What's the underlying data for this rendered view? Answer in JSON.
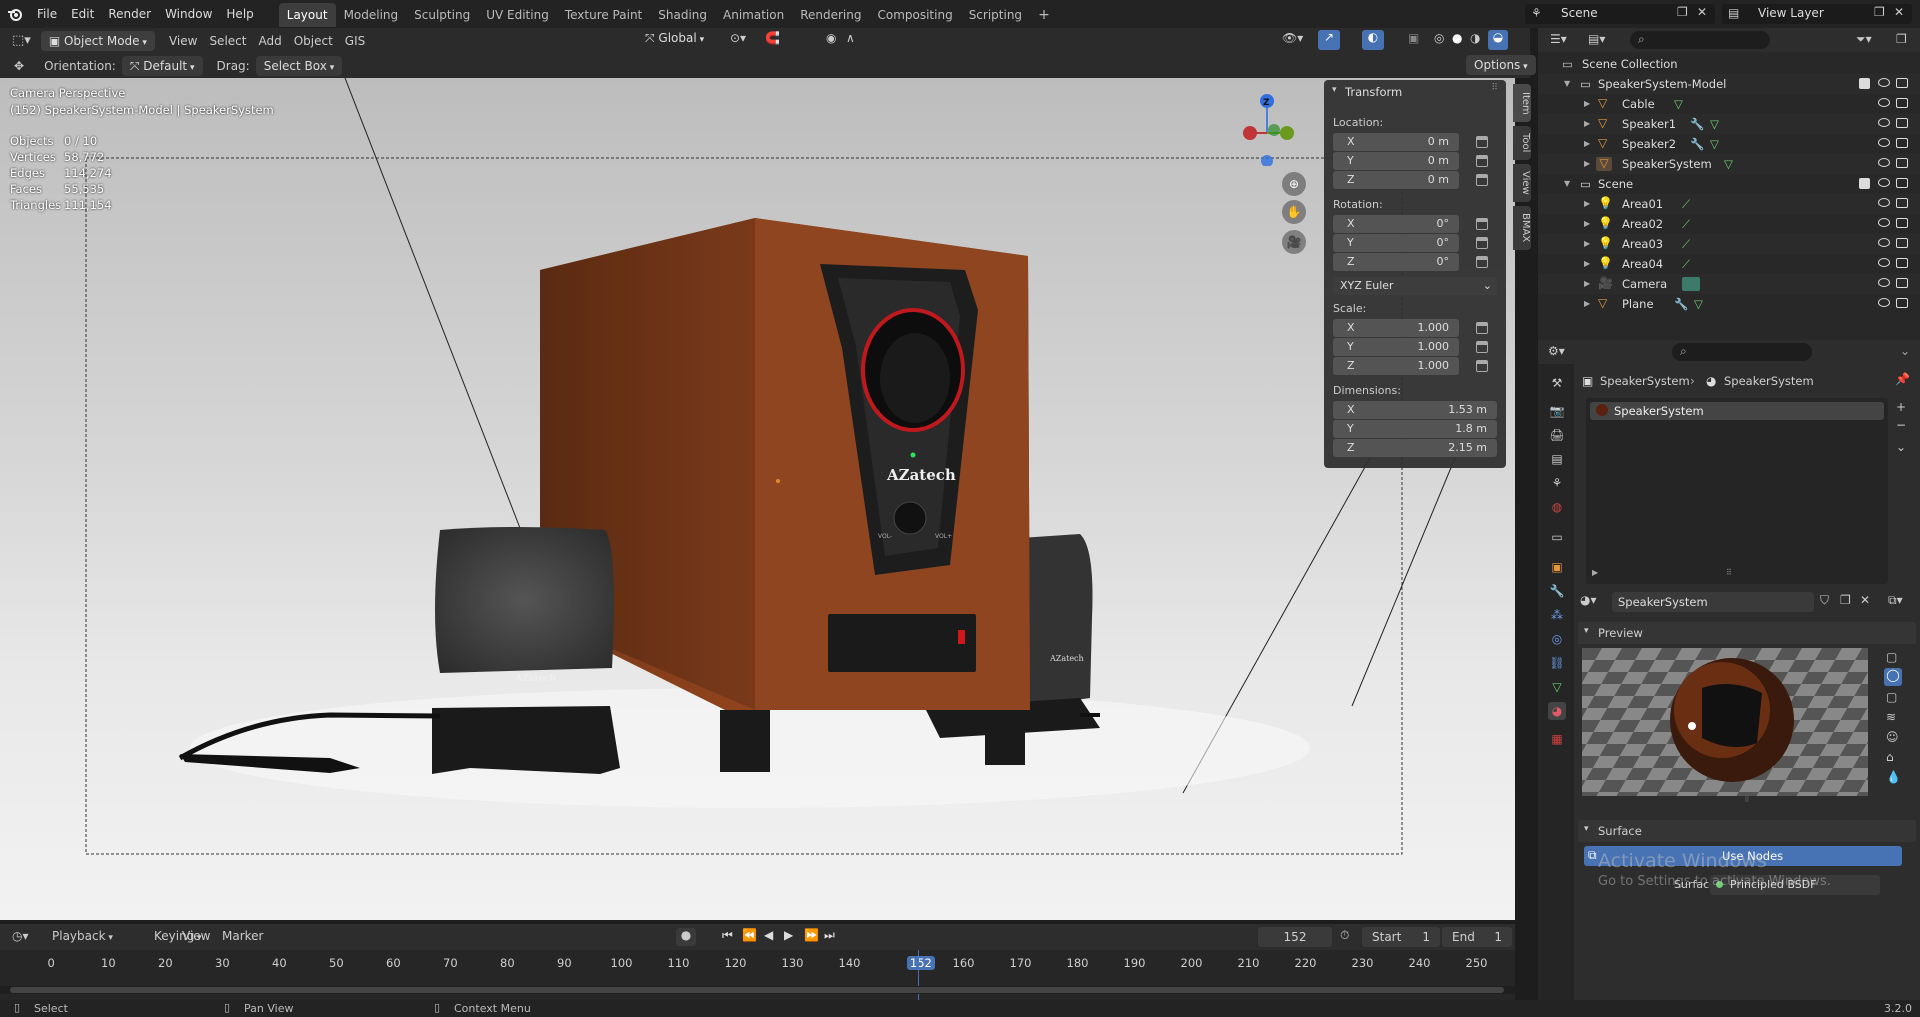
{
  "menubar": {
    "logo": "blender-logo-icon",
    "menus": [
      "File",
      "Edit",
      "Render",
      "Window",
      "Help"
    ],
    "workspaces": [
      "Layout",
      "Modeling",
      "Sculpting",
      "UV Editing",
      "Texture Paint",
      "Shading",
      "Animation",
      "Rendering",
      "Compositing",
      "Scripting"
    ],
    "active_workspace": "Layout",
    "add_tab": "+",
    "scene": "Scene",
    "view_layer": "View Layer"
  },
  "viewport_header": {
    "mode": "Object Mode",
    "menus": [
      "View",
      "Select",
      "Add",
      "Object",
      "GIS"
    ],
    "transform_orientation": "Global",
    "options": "Options"
  },
  "tool_header": {
    "orientation_label": "Orientation:",
    "orientation_value": "Default",
    "drag_label": "Drag:",
    "drag_value": "Select Box"
  },
  "viewport": {
    "view_name": "Camera Perspective",
    "object_info": "(152) SpeakerSystem-Model | SpeakerSystem",
    "stats": [
      {
        "label": "Objects",
        "value": "0 / 10"
      },
      {
        "label": "Vertices",
        "value": "58,772"
      },
      {
        "label": "Edges",
        "value": "114,274"
      },
      {
        "label": "Faces",
        "value": "55,535"
      },
      {
        "label": "Triangles",
        "value": "111,154"
      }
    ],
    "gizmo_axes": [
      "Z",
      "X",
      "Y"
    ],
    "brand_text": "AZatech",
    "knob_left": "VOL-",
    "knob_right": "VOL+",
    "satellite_brand": "AZatech",
    "satellite_brand_right": "AZatech"
  },
  "npanel": {
    "title": "Transform",
    "location_label": "Location:",
    "location": [
      {
        "axis": "X",
        "value": "0 m"
      },
      {
        "axis": "Y",
        "value": "0 m"
      },
      {
        "axis": "Z",
        "value": "0 m"
      }
    ],
    "rotation_label": "Rotation:",
    "rotation": [
      {
        "axis": "X",
        "value": "0°"
      },
      {
        "axis": "Y",
        "value": "0°"
      },
      {
        "axis": "Z",
        "value": "0°"
      }
    ],
    "rotation_mode": "XYZ Euler",
    "scale_label": "Scale:",
    "scale": [
      {
        "axis": "X",
        "value": "1.000"
      },
      {
        "axis": "Y",
        "value": "1.000"
      },
      {
        "axis": "Z",
        "value": "1.000"
      }
    ],
    "dimensions_label": "Dimensions:",
    "dimensions": [
      {
        "axis": "X",
        "value": "1.53 m"
      },
      {
        "axis": "Y",
        "value": "1.8 m"
      },
      {
        "axis": "Z",
        "value": "2.15 m"
      }
    ],
    "tabs": [
      "Item",
      "Tool",
      "View",
      "BMAX"
    ]
  },
  "outliner": {
    "root": "Scene Collection",
    "items": [
      {
        "name": "SpeakerSystem-Model",
        "type": "collection"
      },
      {
        "name": "Cable",
        "type": "mesh"
      },
      {
        "name": "Speaker1",
        "type": "mesh"
      },
      {
        "name": "Speaker2",
        "type": "mesh"
      },
      {
        "name": "SpeakerSystem",
        "type": "mesh"
      },
      {
        "name": "Scene",
        "type": "collection"
      },
      {
        "name": "Area01",
        "type": "light"
      },
      {
        "name": "Area02",
        "type": "light"
      },
      {
        "name": "Area03",
        "type": "light"
      },
      {
        "name": "Area04",
        "type": "light"
      },
      {
        "name": "Camera",
        "type": "camera"
      },
      {
        "name": "Plane",
        "type": "mesh"
      }
    ]
  },
  "properties": {
    "breadcrumb_object": "SpeakerSystem",
    "breadcrumb_material": "SpeakerSystem",
    "slot": "SpeakerSystem",
    "material_name": "SpeakerSystem",
    "preview_label": "Preview",
    "surface_label": "Surface",
    "use_nodes": "Use Nodes",
    "surface_field_label": "Surface",
    "surface_shader": "Principled BSDF",
    "watermark_title": "Activate Windows",
    "watermark_sub": "Go to Settings to activate Windows."
  },
  "timeline": {
    "menus": [
      "Playback",
      "Keying",
      "View",
      "Marker"
    ],
    "current_frame": "152",
    "start_label": "Start",
    "start": "1",
    "end_label": "End",
    "end": "1",
    "ticks": [
      "0",
      "10",
      "20",
      "30",
      "40",
      "50",
      "60",
      "70",
      "80",
      "90",
      "100",
      "110",
      "120",
      "130",
      "140",
      "152",
      "160",
      "170",
      "180",
      "190",
      "200",
      "210",
      "220",
      "230",
      "240",
      "250"
    ]
  },
  "statusbar": {
    "select": "Select",
    "pan": "Pan View",
    "context": "Context Menu",
    "version": "3.2.0"
  }
}
